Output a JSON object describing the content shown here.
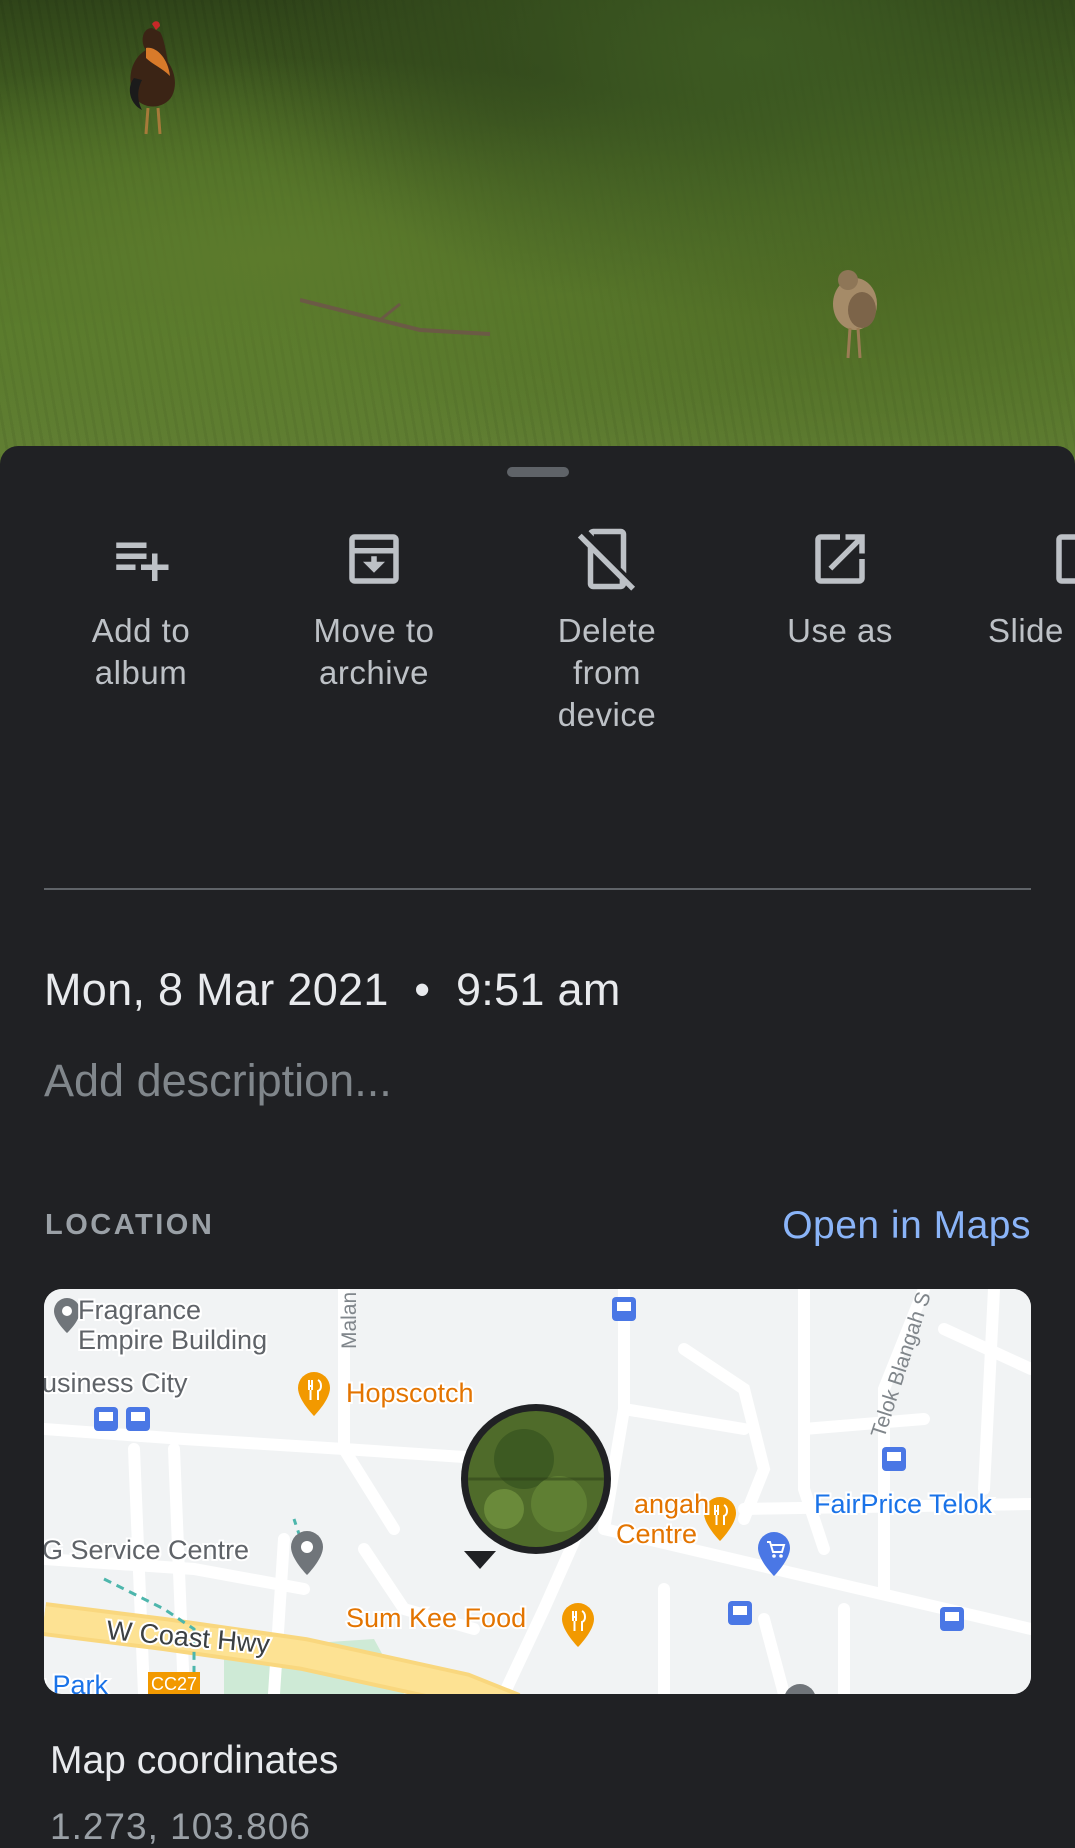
{
  "actions": [
    {
      "label": "Add to\nalbum",
      "icon": "playlist-add-icon"
    },
    {
      "label": "Move to\narchive",
      "icon": "archive-icon"
    },
    {
      "label": "Delete\nfrom\ndevice",
      "icon": "phone-off-icon"
    },
    {
      "label": "Use as",
      "icon": "open-in-new-icon"
    },
    {
      "label": "Slide",
      "icon": "slideshow-icon"
    }
  ],
  "details": {
    "datetime": "Mon, 8 Mar 2021  •  9:51 am",
    "description_placeholder": "Add description..."
  },
  "location": {
    "section_label": "LOCATION",
    "open_maps_label": "Open in Maps",
    "map_labels": {
      "fragrance": "Fragrance",
      "empire": "Empire Building",
      "business_city": "usiness City",
      "hopscotch": "Hopscotch",
      "malan": "Malan",
      "telok_blangah": "Telok Blangah S",
      "fairprice": "FairPrice Telok",
      "bangah": "angah",
      "centre": "Centre",
      "service_centre": "G Service Centre",
      "sum_kee": "Sum Kee Food",
      "w_coast": "W Coast Hwy",
      "park": "r Park",
      "cc27": "CC27"
    },
    "colors": {
      "map_bg": "#f1f3f4",
      "food_pin": "#f29900",
      "food_text": "#e37400",
      "bus_stop": "#4a77e5",
      "highway": "#fde293"
    }
  },
  "coordinates": {
    "title": "Map coordinates",
    "value": "1.273, 103.806"
  }
}
